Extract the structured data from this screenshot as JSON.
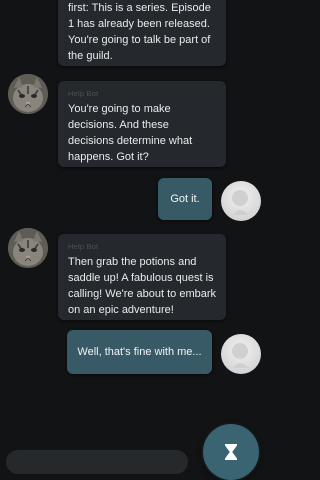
{
  "messages": [
    {
      "id": "m1",
      "sender": "",
      "lines": [
        "first: This is a series. Episode",
        "1 has already been released.",
        "You're going to talk be part of",
        "the guild."
      ]
    },
    {
      "id": "m2",
      "sender": "Help Bot",
      "lines": [
        "You're going to make",
        "decisions. And these",
        "decisions determine what",
        "happens. Got it?"
      ]
    },
    {
      "id": "m3",
      "sender": "user",
      "text": "Got it."
    },
    {
      "id": "m4",
      "sender": "Help Bot",
      "lines": [
        "Then grab the potions and",
        "saddle up! A fabulous quest is",
        "calling! We're about to embark",
        "on an epic adventure!"
      ]
    },
    {
      "id": "m5",
      "sender": "user",
      "text": "Well, that's fine with me..."
    }
  ],
  "input": {
    "placeholder": ""
  },
  "icons": {
    "fab": "hourglass-icon",
    "bot_avatar": "cat-avatar",
    "user_avatar": "user-avatar"
  },
  "colors": {
    "background": "#121315",
    "bot_bubble": "#25292d",
    "user_bubble": "#375a66",
    "fab": "#3a6472"
  }
}
